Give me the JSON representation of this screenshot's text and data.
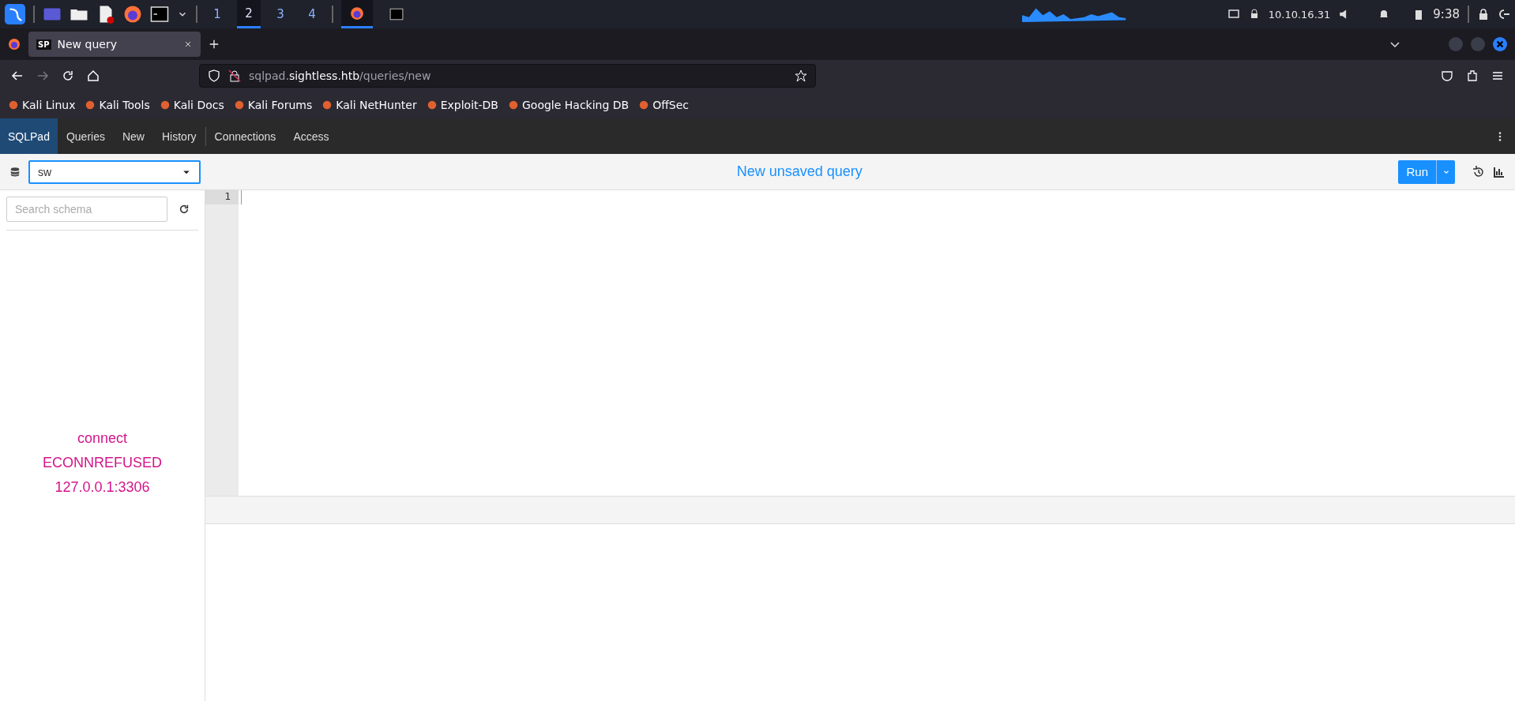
{
  "taskbar": {
    "workspaces": [
      {
        "label": "1",
        "selected": false
      },
      {
        "label": "2",
        "selected": true
      },
      {
        "label": "3",
        "selected": false
      },
      {
        "label": "4",
        "selected": false
      }
    ],
    "ip": "10.10.16.31",
    "time": "9:38"
  },
  "browser": {
    "tab": {
      "favicon": "SP",
      "title": "New query",
      "selected": true
    },
    "url": {
      "prefix": "sqlpad.",
      "domain": "sightless.htb",
      "path": "/queries/new"
    },
    "bookmarks": [
      "Kali Linux",
      "Kali Tools",
      "Kali Docs",
      "Kali Forums",
      "Kali NetHunter",
      "Exploit-DB",
      "Google Hacking DB",
      "OffSec"
    ]
  },
  "sqlpad": {
    "brand": "SQLPad",
    "nav": [
      {
        "label": "Queries",
        "divider_before": false
      },
      {
        "label": "New",
        "divider_before": false
      },
      {
        "label": "History",
        "divider_before": false
      },
      {
        "label": "Connections",
        "divider_before": true
      },
      {
        "label": "Access",
        "divider_before": false
      }
    ],
    "connection": "sw",
    "query_title": "New unsaved query",
    "run_button": "Run",
    "schema_search": {
      "placeholder": "Search schema"
    },
    "error": "connect ECONNREFUSED 127.0.0.1:3306",
    "editor": {
      "line_numbers": [
        "1"
      ]
    }
  }
}
